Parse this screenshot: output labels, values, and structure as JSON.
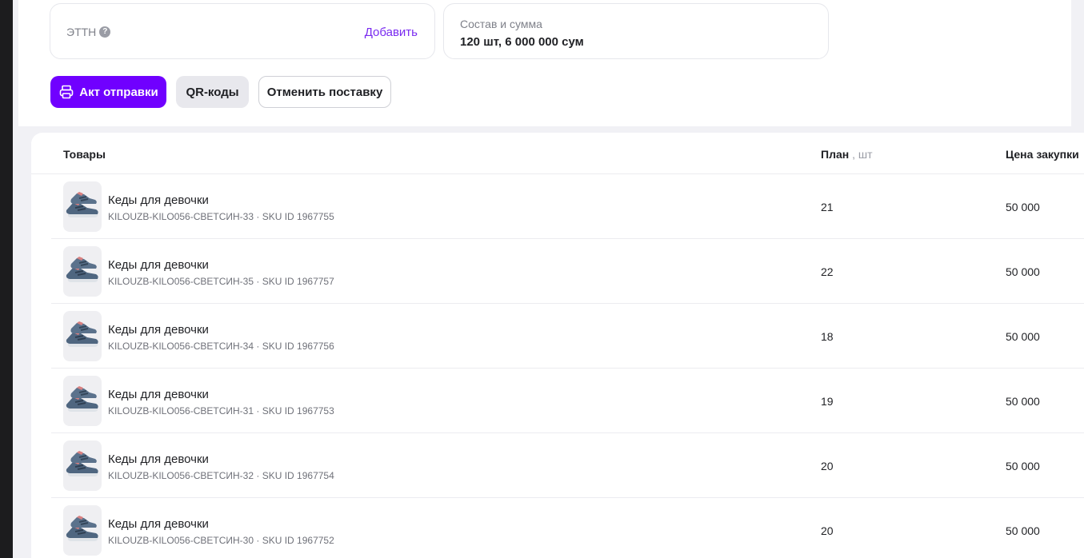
{
  "ettn": {
    "label": "ЭТТН",
    "help_icon": "?",
    "add_label": "Добавить"
  },
  "summary": {
    "label": "Состав и сумма",
    "value": "120 шт, 6 000 000 сум"
  },
  "actions": {
    "act_label": "Акт отправки",
    "qr_label": "QR-коды",
    "cancel_label": "Отменить поставку"
  },
  "table": {
    "headers": {
      "goods": "Товары",
      "plan": "План",
      "plan_unit": ", шт",
      "price": "Цена закупки"
    },
    "rows": [
      {
        "name": "Кеды для девочки",
        "sku": "KILOUZB-KILO056-СВЕТСИН-33",
        "sku_id": "SKU ID 1967755",
        "plan": "21",
        "price": "50 000"
      },
      {
        "name": "Кеды для девочки",
        "sku": "KILOUZB-KILO056-СВЕТСИН-35",
        "sku_id": "SKU ID 1967757",
        "plan": "22",
        "price": "50 000"
      },
      {
        "name": "Кеды для девочки",
        "sku": "KILOUZB-KILO056-СВЕТСИН-34",
        "sku_id": "SKU ID 1967756",
        "plan": "18",
        "price": "50 000"
      },
      {
        "name": "Кеды для девочки",
        "sku": "KILOUZB-KILO056-СВЕТСИН-31",
        "sku_id": "SKU ID 1967753",
        "plan": "19",
        "price": "50 000"
      },
      {
        "name": "Кеды для девочки",
        "sku": "KILOUZB-KILO056-СВЕТСИН-32",
        "sku_id": "SKU ID 1967754",
        "plan": "20",
        "price": "50 000"
      },
      {
        "name": "Кеды для девочки",
        "sku": "KILOUZB-KILO056-СВЕТСИН-30",
        "sku_id": "SKU ID 1967752",
        "plan": "20",
        "price": "50 000"
      }
    ]
  },
  "icons": {
    "act": "printer-icon",
    "product": "sneaker-thumbnail"
  },
  "colors": {
    "accent": "#7000ff",
    "link": "#7a2bf0"
  }
}
